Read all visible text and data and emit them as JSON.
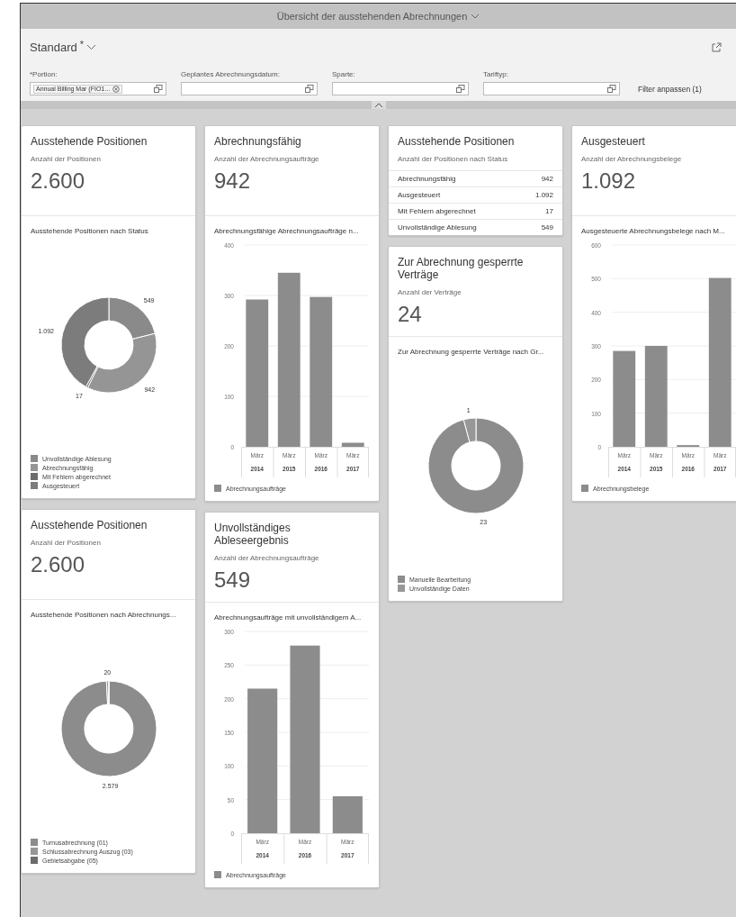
{
  "title": {
    "text": "Übersicht der ausstehenden Abrechnungen"
  },
  "variant": {
    "name": "Standard",
    "marker": "*"
  },
  "filters": [
    {
      "label": "*Portion:",
      "tokens": [
        "Annual Billing Mar (FIO1..."
      ]
    },
    {
      "label": "Geplantes Abrechnungsdatum:"
    },
    {
      "label": "Sparte:"
    },
    {
      "label": "Tariftyp:"
    }
  ],
  "adapt_filters": "Filter anpassen (1)",
  "columns": [
    {
      "cards": [
        {
          "kind": "chart",
          "title": "Ausstehende Positionen",
          "subtitle": "Anzahl der Positionen",
          "value": "2.600",
          "chart_title": "Ausstehende Positionen nach Status",
          "legend": [
            {
              "color": "#8a8a8a"
            },
            {
              "color": "#959595"
            },
            {
              "color": "#6c6c6c"
            },
            {
              "color": "#7c7c7c"
            }
          ],
          "chart_data": {
            "type": "donut",
            "categories": [
              "Unvollständige Ablesung",
              "Abrechnungsfähig",
              "Mit Fehlern abgerechnet",
              "Ausgesteuert"
            ],
            "values": [
              549,
              942,
              17,
              1092
            ],
            "value_labels": [
              "549",
              "942",
              "17",
              "1.092"
            ]
          }
        },
        {
          "kind": "chart",
          "title": "Ausstehende Positionen",
          "subtitle": "Anzahl der Positionen",
          "value": "2.600",
          "chart_title": "Ausstehende Positionen nach Abrechnungs...",
          "legend": [
            {
              "color": "#8c8c8c"
            },
            {
              "color": "#979797"
            },
            {
              "color": "#6c6c6c"
            }
          ],
          "chart_data": {
            "type": "donut",
            "categories": [
              "Turnusabrechnung (01)",
              "Schlussabrechnung Auszug (03)",
              "Gebietsabgabe (05)"
            ],
            "values": [
              2579,
              20,
              1
            ],
            "value_labels": [
              "2.579",
              "20",
              null
            ]
          }
        }
      ]
    },
    {
      "cards": [
        {
          "kind": "chart",
          "title": "Abrechnungsfähig",
          "subtitle": "Anzahl der Abrechnungsaufträge",
          "value": "942",
          "chart_title": "Abrechnungsfähige Abrechnungsaufträge n...",
          "chart_data": {
            "type": "bar",
            "grid": true,
            "categories": [
              "März 2014",
              "März 2015",
              "März 2016",
              "März 2017"
            ],
            "series": [
              {
                "name": "Abrechnungsaufträge",
                "color": "#8c8c8c",
                "values": [
                  292,
                  345,
                  297,
                  8
                ]
              }
            ],
            "ylim": [
              0,
              400
            ],
            "yticks": [
              0,
              100,
              200,
              300,
              400
            ]
          }
        },
        {
          "kind": "chart",
          "title": "Unvollständiges Ableseergebnis",
          "subtitle": "Anzahl der Abrechnungsaufträge",
          "value": "549",
          "chart_title": "Abrechnungsaufträge mit unvollständigem A...",
          "chart_data": {
            "type": "bar",
            "grid": true,
            "categories": [
              "März 2014",
              "März 2016",
              "März 2017"
            ],
            "series": [
              {
                "name": "Abrechnungsaufträge",
                "color": "#8c8c8c",
                "values": [
                  215,
                  279,
                  55
                ]
              }
            ],
            "ylim": [
              0,
              300
            ],
            "yticks": [
              0,
              50,
              100,
              150,
              200,
              250,
              300
            ]
          }
        }
      ]
    },
    {
      "cards": [
        {
          "kind": "list",
          "title": "Ausstehende Positionen",
          "subtitle": "Anzahl der Positionen nach Status",
          "rows": [
            {
              "label": "Abrechnungsfähig",
              "value": "942"
            },
            {
              "label": "Ausgesteuert",
              "value": "1.092"
            },
            {
              "label": "Mit Fehlern abgerechnet",
              "value": "17"
            },
            {
              "label": "Unvollständige Ablesung",
              "value": "549"
            }
          ]
        },
        {
          "kind": "chart",
          "title": "Zur Abrechnung gesperrte Verträge",
          "subtitle": "Anzahl der Verträge",
          "value": "24",
          "chart_title": "Zur Abrechnung gesperrte Verträge nach Gr...",
          "legend": [
            {
              "color": "#8c8c8c"
            },
            {
              "color": "#979797"
            }
          ],
          "chart_data": {
            "type": "donut",
            "categories": [
              "Manuelle Bearbeitung",
              "Unvollständige Daten"
            ],
            "values": [
              23,
              1
            ],
            "value_labels": [
              "23",
              "1"
            ]
          }
        }
      ]
    },
    {
      "cards": [
        {
          "kind": "chart",
          "title": "Ausgesteuert",
          "subtitle": "Anzahl der Abrechnungsbelege",
          "value": "1.092",
          "chart_title": "Ausgesteuerte Abrechnungsbelege nach M...",
          "chart_data": {
            "type": "bar",
            "grid": true,
            "categories": [
              "März 2014",
              "März 2015",
              "März 2016",
              "März 2017"
            ],
            "series": [
              {
                "name": "Abrechnungsbelege",
                "color": "#8c8c8c",
                "values": [
                  285,
                  300,
                  5,
                  502
                ]
              }
            ],
            "ylim": [
              0,
              600
            ],
            "yticks": [
              0,
              100,
              200,
              300,
              400,
              500,
              600
            ]
          }
        }
      ]
    }
  ]
}
